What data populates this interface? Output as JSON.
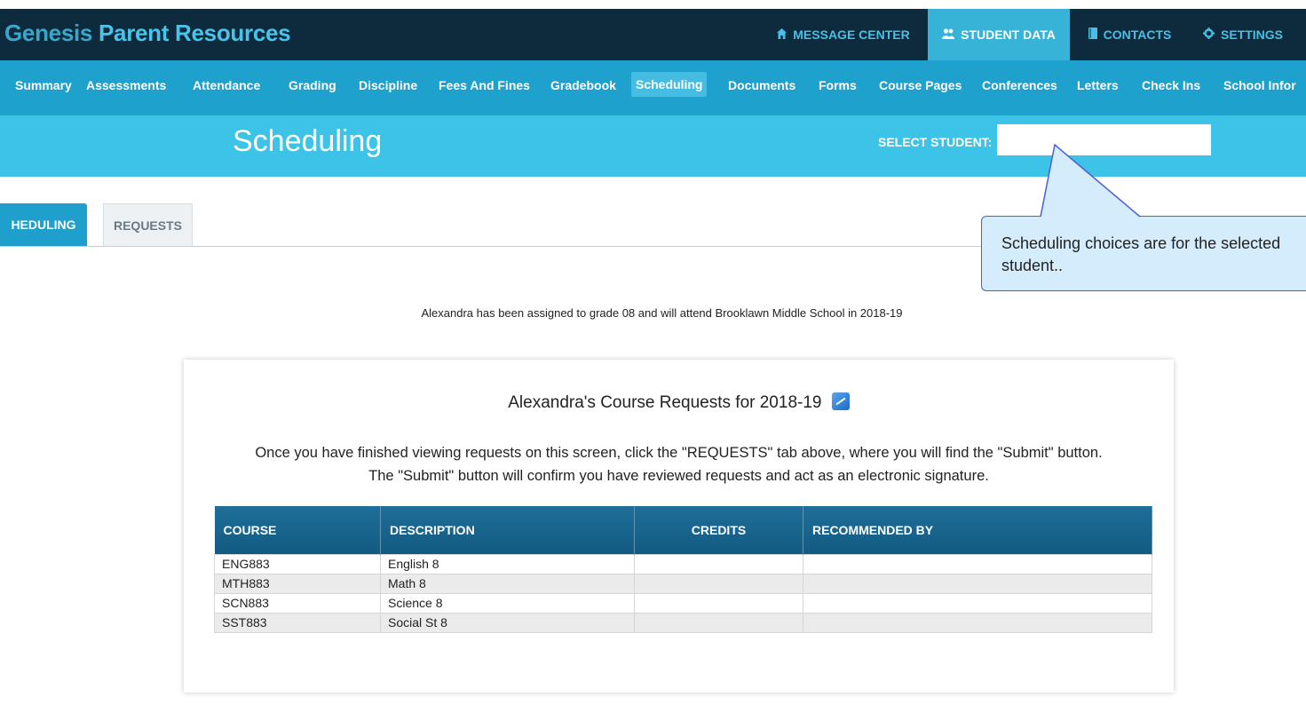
{
  "app": {
    "brand_part1": "Genesis",
    "brand_part2": " Parent Resources",
    "top_nav": [
      {
        "label": "MESSAGE CENTER",
        "icon": "home-icon"
      },
      {
        "label": "STUDENT DATA",
        "icon": "users-icon"
      },
      {
        "label": "CONTACTS",
        "icon": "book-icon"
      },
      {
        "label": "SETTINGS",
        "icon": "gear-icon"
      }
    ]
  },
  "subnav": [
    "Summary",
    "Assessments",
    "Attendance",
    "Grading",
    "Discipline",
    "Fees And Fines",
    "Gradebook",
    "Scheduling",
    "Documents",
    "Forms",
    "Course Pages",
    "Conferences",
    "Letters",
    "Check Ins",
    "School Infor"
  ],
  "header": {
    "title": "Scheduling",
    "select_label": "SELECT STUDENT:",
    "select_value": ""
  },
  "tabs": {
    "scheduling": "HEDULING",
    "requests": "REQUESTS"
  },
  "callout": {
    "text": "Scheduling choices are for the selected student.."
  },
  "assignment_text": "Alexandra has been assigned to grade 08 and will attend Brooklawn Middle School in 2018-19",
  "card": {
    "title": "Alexandra's Course Requests for 2018-19",
    "instruction_line1": "Once you have finished viewing requests on this screen, click the \"REQUESTS\" tab above, where you will find the \"Submit\" button.",
    "instruction_line2": "The \"Submit\" button will confirm you have reviewed requests and act as an electronic signature."
  },
  "table": {
    "headers": [
      "COURSE",
      "DESCRIPTION",
      "CREDITS",
      "RECOMMENDED BY"
    ],
    "rows": [
      {
        "course": "ENG883",
        "description": "English 8",
        "credits": "",
        "recommended_by": ""
      },
      {
        "course": "MTH883",
        "description": "Math 8",
        "credits": "",
        "recommended_by": ""
      },
      {
        "course": "SCN883",
        "description": "Science 8",
        "credits": "",
        "recommended_by": ""
      },
      {
        "course": "SST883",
        "description": "Social St 8",
        "credits": "",
        "recommended_by": ""
      }
    ]
  },
  "colors": {
    "top_bar": "#0e2b3d",
    "accent": "#1ea1cd",
    "header_band": "#3dc3e7",
    "table_header": "#1a6690",
    "callout_bg": "#d4ecfb",
    "callout_border": "#4b5ed8"
  }
}
